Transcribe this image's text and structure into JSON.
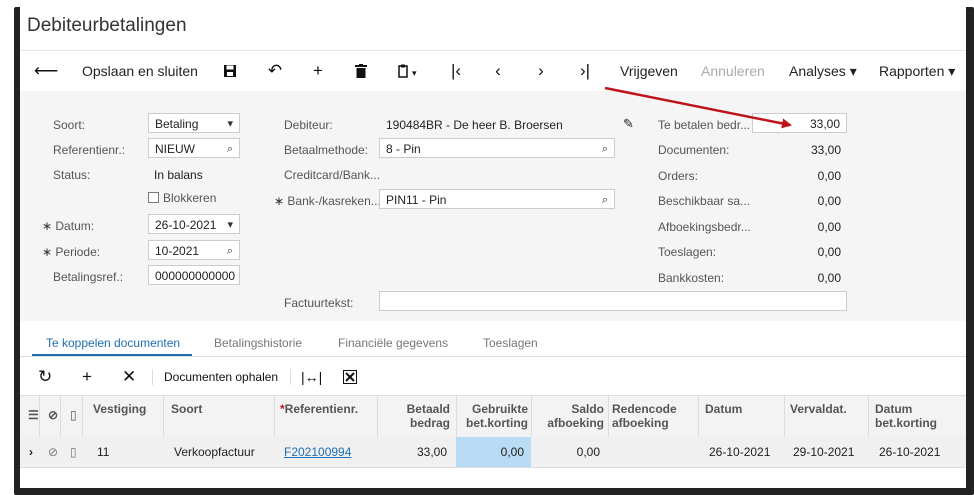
{
  "title": "Debiteurbetalingen",
  "toolbar": {
    "save_close": "Opslaan en sluiten",
    "release": "Vrijgeven",
    "cancel": "Annuleren",
    "analyses": "Analyses ▾",
    "reports": "Rapporten ▾"
  },
  "form": {
    "type_label": "Soort:",
    "type_value": "Betaling",
    "ref_label": "Referentienr.:",
    "ref_value": "NIEUW",
    "status_label": "Status:",
    "status_value": "In balans",
    "hold_label": "Blokkeren",
    "date_label": "Datum:",
    "date_value": "26-10-2021",
    "period_label": "Periode:",
    "period_value": "10-2021",
    "payref_label": "Betalingsref.:",
    "payref_value": "000000000000",
    "customer_label": "Debiteur:",
    "customer_value": "190484BR - De heer B. Broersen",
    "method_label": "Betaalmethode:",
    "method_value": "8 - Pin",
    "card_label": "Creditcard/Bank...",
    "cash_label": "Bank-/kasreken...",
    "cash_value": "PIN11 - Pin",
    "invoice_text_label": "Factuurtekst:",
    "invoice_text_value": ""
  },
  "totals": [
    {
      "label": "Te betalen bedr...",
      "value": "33,00"
    },
    {
      "label": "Documenten:",
      "value": "33,00"
    },
    {
      "label": "Orders:",
      "value": "0,00"
    },
    {
      "label": "Beschikbaar sa...",
      "value": "0,00"
    },
    {
      "label": "Afboekingsbedr...",
      "value": "0,00"
    },
    {
      "label": "Toeslagen:",
      "value": "0,00"
    },
    {
      "label": "Bankkosten:",
      "value": "0,00"
    }
  ],
  "tabs": [
    "Te koppelen documenten",
    "Betalingshistorie",
    "Financiële gegevens",
    "Toeslagen"
  ],
  "grid_toolbar": {
    "fetch_docs": "Documenten ophalen"
  },
  "columns": {
    "branch": "Vestiging",
    "type": "Soort",
    "ref": "Referentienr.",
    "paid1": "Betaald",
    "paid2": "bedrag",
    "disc1": "Gebruikte",
    "disc2": "bet.korting",
    "bal1": "Saldo",
    "bal2": "afboeking",
    "reason1": "Redencode",
    "reason2": "afboeking",
    "date": "Datum",
    "due": "Vervaldat.",
    "discdate1": "Datum",
    "discdate2": "bet.korting"
  },
  "row": {
    "branch": "11",
    "type": "Verkoopfactuur",
    "ref": "F202100994",
    "paid": "33,00",
    "disc": "0,00",
    "bal": "0,00",
    "reason": "",
    "date": "26-10-2021",
    "due": "29-10-2021",
    "discdate": "26-10-2021"
  },
  "colors": {
    "accent": "#1e6fb4",
    "arrow": "#c0141b",
    "highlight": "#b9dbf4"
  }
}
